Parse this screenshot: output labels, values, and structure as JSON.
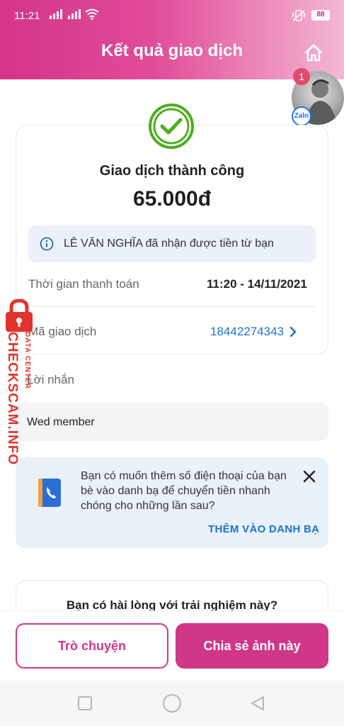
{
  "status_bar": {
    "time": "11:21",
    "battery": "88"
  },
  "header": {
    "title": "Kết quả giao dịch"
  },
  "zalo": {
    "badge_count": "1",
    "label": "Zalo"
  },
  "receipt": {
    "status": "Giao dịch thành công",
    "amount": "65.000đ",
    "info": "LÊ VĂN NGHĨA đã nhận được tiền từ bạn",
    "payment_time_label": "Thời gian thanh toán",
    "payment_time_value": "11:20 - 14/11/2021",
    "transaction_id_label": "Mã giao dịch",
    "transaction_id_value": "18442274343"
  },
  "message": {
    "label": "Lời nhắn",
    "value": "Wed member"
  },
  "contact_prompt": {
    "text": "Bạn có muốn thêm số điện thoại của bạn bè vào danh bạ để chuyển tiền nhanh chóng cho những lần sau?",
    "action": "THÊM VÀO DANH BẠ"
  },
  "feedback": {
    "question": "Bạn có hài lòng với trải nghiệm này?"
  },
  "actions": {
    "chat_label": "Trò chuyện",
    "share_label": "Chia sẻ ảnh này"
  },
  "watermark": {
    "main": "CHECKSCAM.INFO",
    "sub": "DATA CENTER"
  },
  "colors": {
    "brand": "#d03788",
    "link": "#1e73c8",
    "success": "#4caf1e",
    "info_bg": "#eaf1fb"
  },
  "icons": [
    "home-icon",
    "check-circle-icon",
    "info-icon",
    "chevron-right-icon",
    "contacts-book-icon",
    "close-icon",
    "lock-icon"
  ]
}
